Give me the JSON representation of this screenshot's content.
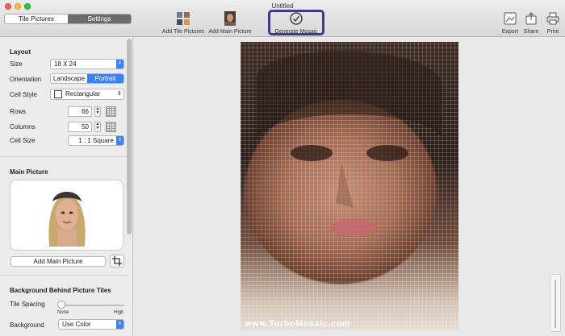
{
  "window": {
    "title": "Untitled"
  },
  "tabs": [
    {
      "label": "Tile Pictures",
      "active": false
    },
    {
      "label": "Settings",
      "active": true
    }
  ],
  "toolbar": {
    "add_tile_pictures": "Add Tile Pictures",
    "add_main_picture": "Add Main Picture",
    "generate_mosaic": "Generate Mosaic",
    "export": "Export",
    "share": "Share",
    "print": "Print"
  },
  "layout": {
    "title": "Layout",
    "size_label": "Size",
    "size_value": "18 X 24",
    "orientation_label": "Orientation",
    "orientation_options": [
      "Landscape",
      "Portrait"
    ],
    "orientation_selected": "Portrait",
    "cell_style_label": "Cell Style",
    "cell_style_value": "Rectangular",
    "rows_label": "Rows",
    "rows_value": "66",
    "columns_label": "Columns",
    "columns_value": "50",
    "cell_size_label": "Cell Size",
    "cell_size_value": "1 : 1 Square"
  },
  "main_picture": {
    "title": "Main Picture",
    "add_button": "Add Main Picture"
  },
  "background": {
    "title": "Background Behind Picture Tiles",
    "tile_spacing_label": "Tile Spacing",
    "tile_spacing_min": "None",
    "tile_spacing_max": "High",
    "tile_spacing_level": 0,
    "background_label": "Background",
    "background_value": "Use Color"
  },
  "mosaic": {
    "watermark": "www.TurboMosaic.com"
  },
  "colors": {
    "accent": "#3b82f6",
    "highlight_box": "#3f3990"
  },
  "icons": [
    "tile-grid-icon",
    "portrait-thumbnail-icon",
    "checkmark-circle-icon",
    "export-icon",
    "share-icon",
    "print-icon",
    "crop-icon"
  ]
}
